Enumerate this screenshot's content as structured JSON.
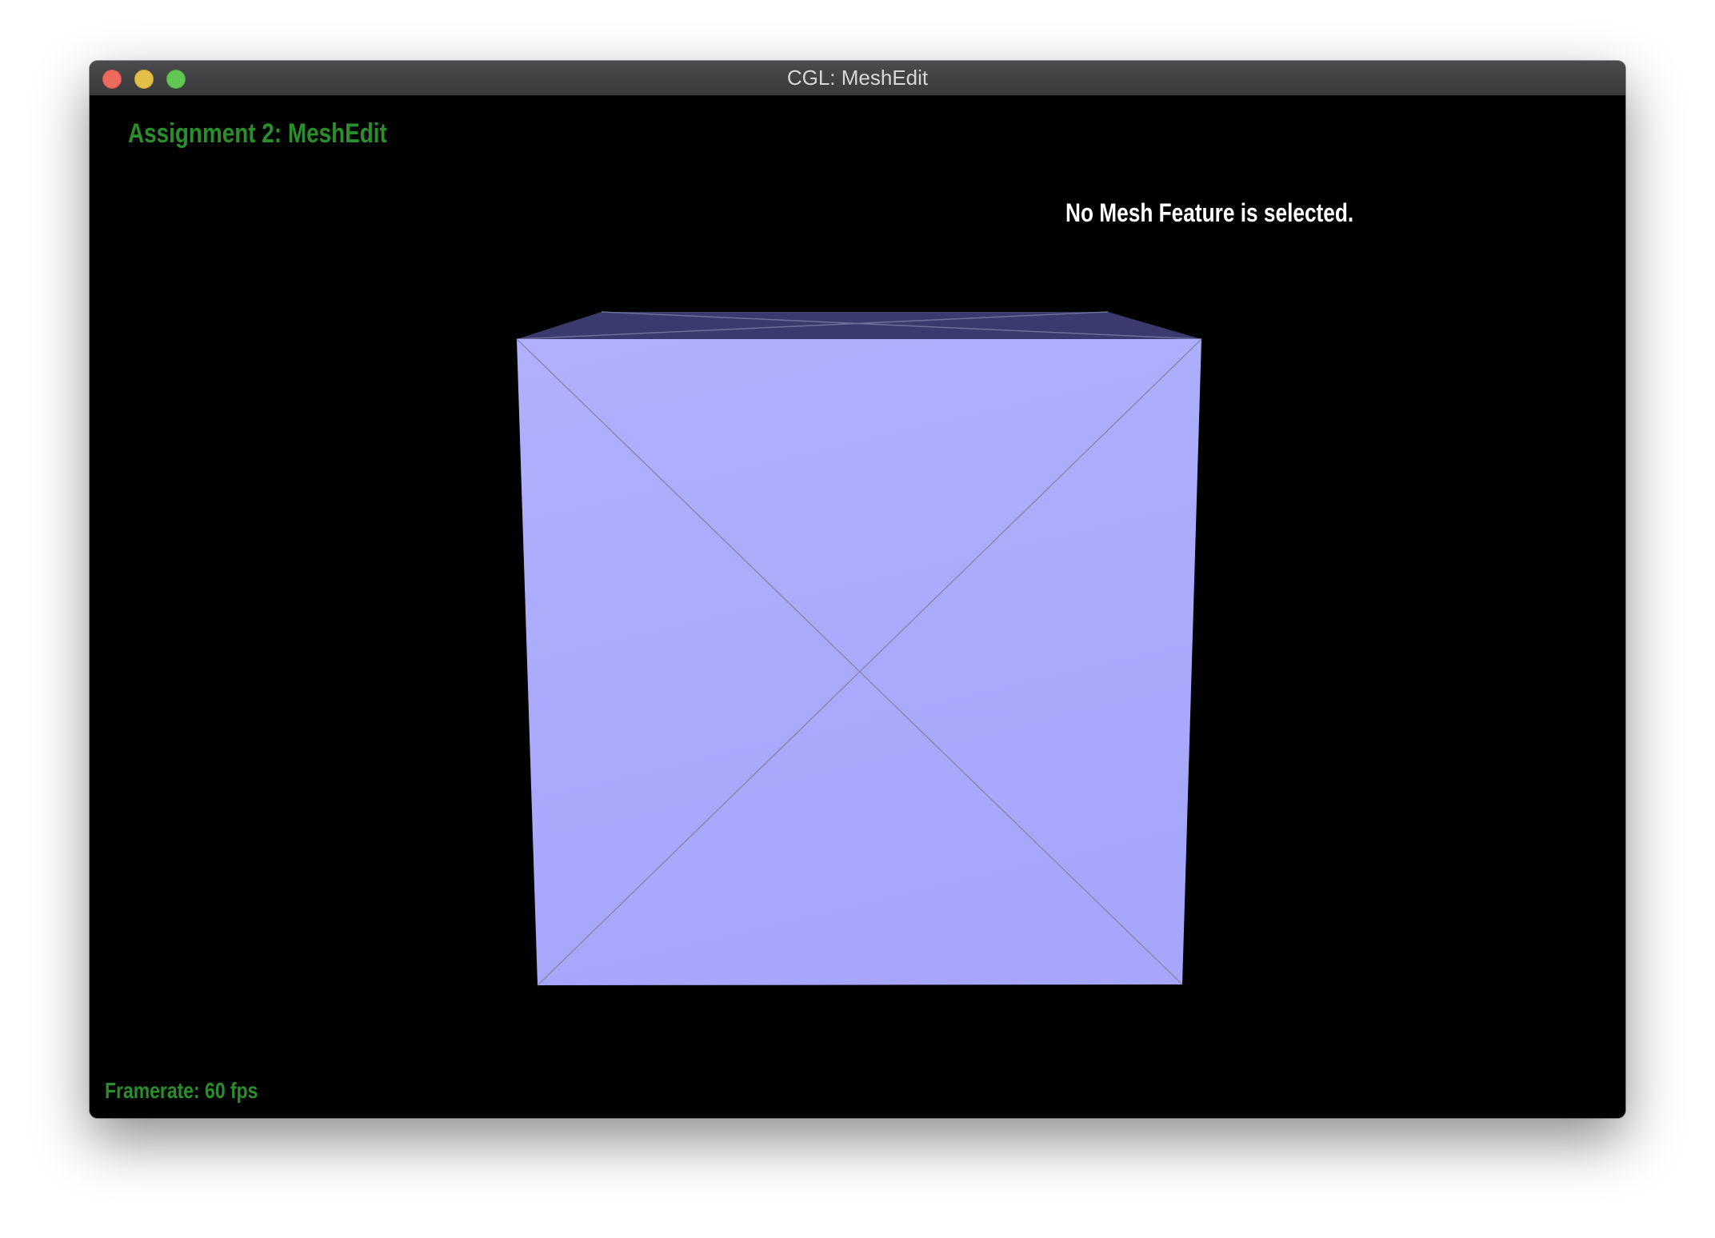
{
  "window": {
    "title": "CGL: MeshEdit",
    "controls": {
      "close_icon": "close-icon",
      "minimize_icon": "minimize-icon",
      "maximize_icon": "maximize-icon"
    }
  },
  "viewport": {
    "app_title": "Assignment 2: MeshEdit",
    "selection_status": "No Mesh Feature is selected.",
    "framerate": "Framerate: 60 fps"
  },
  "colors": {
    "background": "#000000",
    "overlay_green": "#2a8f2a",
    "status_text": "#ffffff",
    "mesh_front_face": "#acacfd",
    "mesh_top_face": "#3a3a6c",
    "mesh_edges": "#7f7fa0"
  }
}
